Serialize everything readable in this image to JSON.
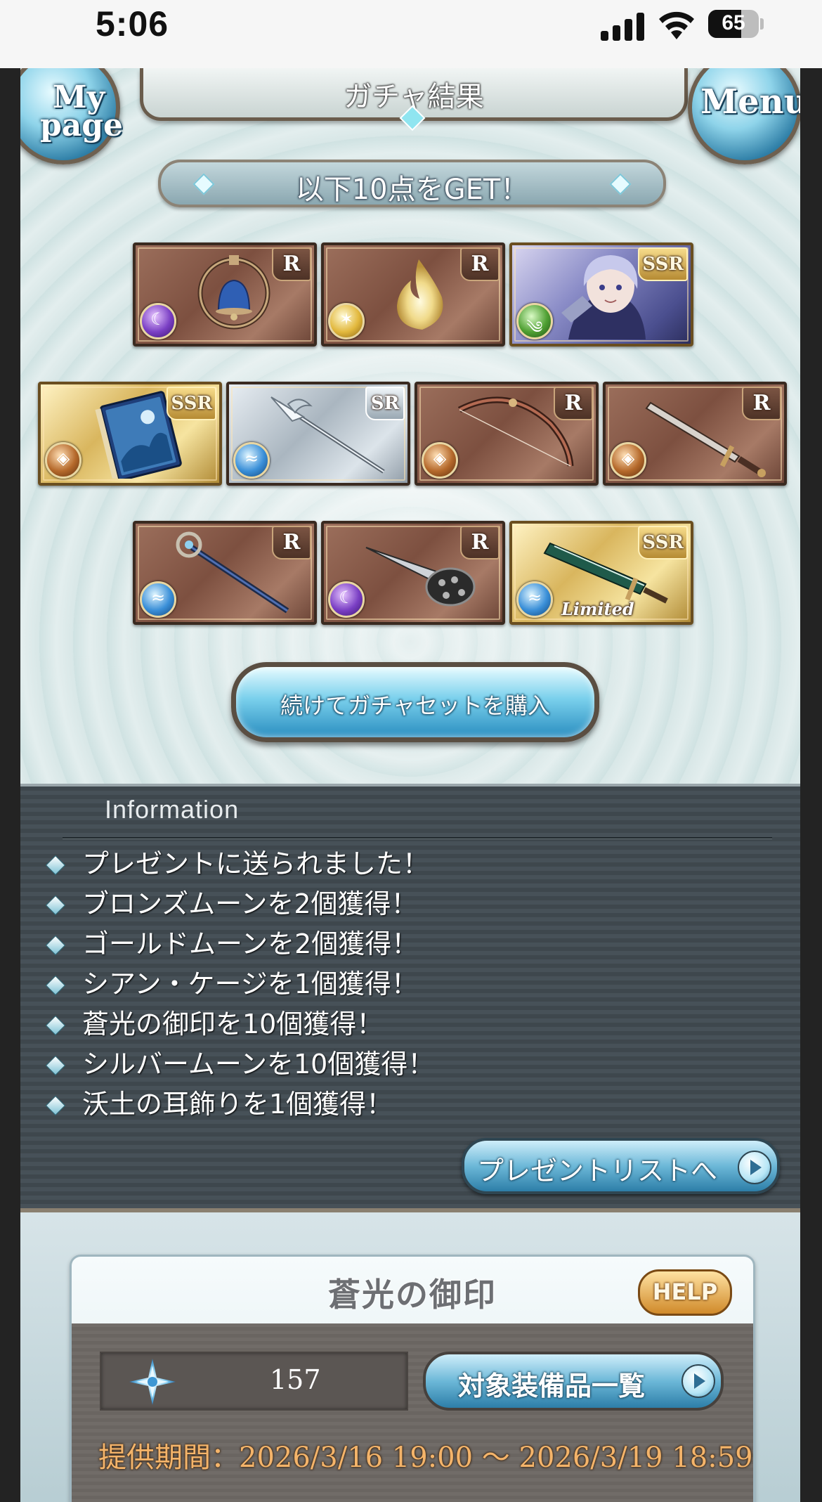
{
  "status_bar": {
    "time": "5:06",
    "battery": "65"
  },
  "header": {
    "title": "ガチャ結果",
    "my_page_label_line1": "My",
    "my_page_label_line2": "page",
    "menu_label": "Menu"
  },
  "result_banner": "以下10点をGET！",
  "cards": [
    {
      "rarity": "R",
      "element": "dark",
      "art": "bell-icon"
    },
    {
      "rarity": "R",
      "element": "light",
      "art": "flame-icon"
    },
    {
      "rarity": "SSR",
      "element": "wind",
      "art": "character-portrait"
    },
    {
      "rarity": "SSR",
      "element": "earth",
      "art": "book-icon"
    },
    {
      "rarity": "SR",
      "element": "water",
      "art": "spear-icon"
    },
    {
      "rarity": "R",
      "element": "earth",
      "art": "bow-icon"
    },
    {
      "rarity": "R",
      "element": "earth",
      "art": "sword-icon"
    },
    {
      "rarity": "R",
      "element": "water",
      "art": "staff-icon"
    },
    {
      "rarity": "R",
      "element": "dark",
      "art": "gauntlet-icon"
    },
    {
      "rarity": "SSR",
      "element": "water",
      "art": "greatsword-icon",
      "badge": "Limited"
    }
  ],
  "continue_button": "続けてガチャセットを購入",
  "information": {
    "heading": "Information",
    "items": [
      "プレゼントに送られました！",
      "ブロンズムーンを2個獲得！",
      "ゴールドムーンを2個獲得！",
      "シアン・ケージを1個獲得！",
      "蒼光の御印を10個獲得！",
      "シルバームーンを10個獲得！",
      "沃土の耳飾りを1個獲得！"
    ],
    "present_list_button": "プレゼントリストへ"
  },
  "seal": {
    "title": "蒼光の御印",
    "help_label": "HELP",
    "count": "157",
    "equipment_button": "対象装備品一覧",
    "period": "提供期間：2026/3/16 19:00 〜 2026/3/19 18:59"
  },
  "colors": {
    "status_bar_bg": "#f6f6f6",
    "info_panel_bg": "#434c52",
    "period_text": "#f4b46a",
    "button_blue": "#6cb8d8"
  }
}
